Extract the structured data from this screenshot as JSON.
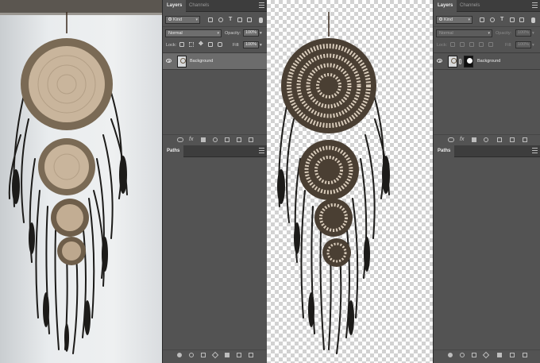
{
  "layers_panel": {
    "tabs": [
      {
        "label": "Layers",
        "active": true
      },
      {
        "label": "Channels",
        "active": false
      }
    ],
    "kind_filter": "Kind",
    "blend_mode": "Normal",
    "opacity_label": "Opacity:",
    "opacity_value": "100%",
    "lock_label": "Lock:",
    "fill_label": "Fill:",
    "fill_value": "100%",
    "layer": {
      "name": "Background",
      "visible": true
    }
  },
  "paths_panel": {
    "tab_label": "Paths"
  },
  "layers_panel_masked": {
    "tabs": [
      {
        "label": "Layers",
        "active": true
      },
      {
        "label": "Channels",
        "active": false
      }
    ],
    "kind_filter": "Kind",
    "blend_mode": "Normal",
    "opacity_label": "Opacity:",
    "opacity_value": "100%",
    "lock_label": "Lock:",
    "fill_label": "Fill:",
    "fill_value": "100%",
    "layer": {
      "name": "Background",
      "visible": true,
      "has_mask": true
    }
  },
  "paths_panel_masked": {
    "tab_label": "Paths"
  },
  "colors": {
    "panel_bg": "#535353",
    "tab_bar": "#3d3d3d",
    "selected_layer": "#6c6c6c",
    "feather_dark": "#1c1b19",
    "hoop_fur": "#7a6a55",
    "web_beige": "#c9b59c"
  }
}
